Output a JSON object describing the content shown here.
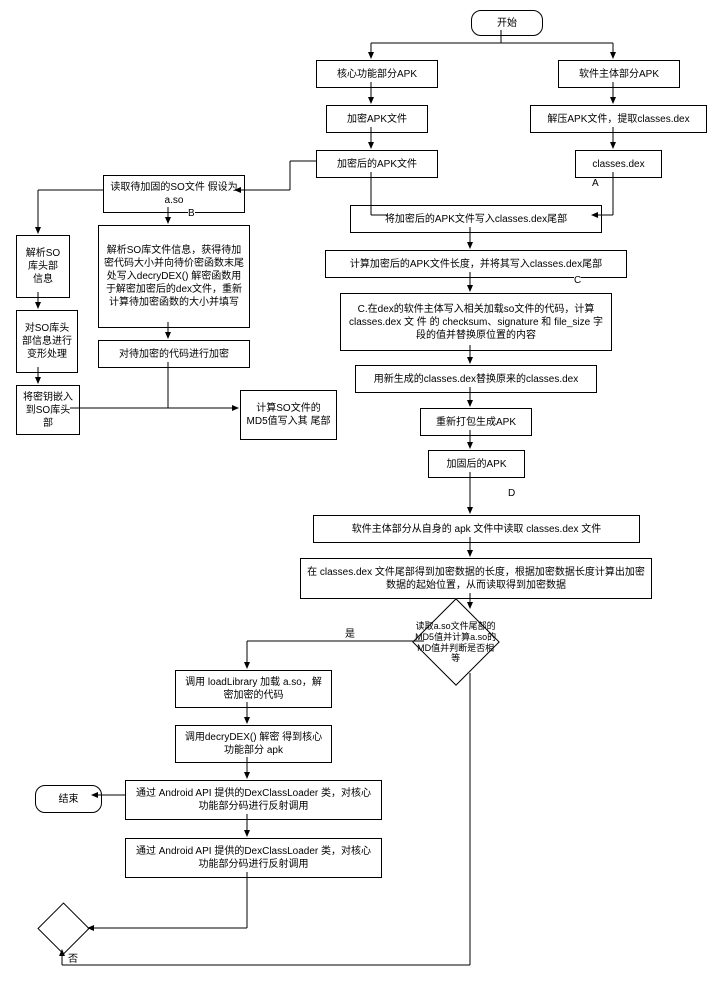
{
  "start": "开始",
  "end": "结束",
  "core_apk": "核心功能部分APK",
  "main_apk": "软件主体部分APK",
  "encrypt_apk": "加密APK文件",
  "extract_classes": "解压APK文件，提取classes.dex",
  "encrypted_apk": "加密后的APK文件",
  "classes_dex": "classes.dex",
  "read_so": "读取待加固的SO文件 假设为a.so",
  "parse_so_header": "解析SO 库头部 信息",
  "deform_so_header": "对SO库头 部信息进行 变形处理",
  "embed_key": "将密钥嵌入 到SO库头 部",
  "parse_so_info": "解析SO库文件信息，获得待加密代码大小并向待价密函数末尾处写入decryDEX() 解密函数用于解密加密后的dex文件，重新计算待加密函数的大小并填写",
  "encrypt_code": "对待加密的代码进行加密",
  "calc_md5_so": "计算SO文件的 MD5值写入其 尾部",
  "write_encrypted_to_dex": "将加密后的APK文件写入classes.dex尾部",
  "calc_apk_len": "计算加密后的APK文件长度，并将其写入classes.dex尾部",
  "write_loader": "C.在dex的软件主体写入相关加载so文件的代码，计算 classes.dex 文 件 的 checksum、signature 和 file_size 字段的值并替换原位置的内容",
  "replace_dex": "用新生成的classes.dex替换原来的classes.dex",
  "repackage": "重新打包生成APK",
  "hardened_apk": "加固后的APK",
  "read_dex_from_apk": "软件主体部分从自身的 apk 文件中读取 classes.dex 文件",
  "read_enc_data": "在 classes.dex 文件尾部得到加密数据的长度，根据加密数据长度计算出加密数据的起始位置，从而读取得到加密数据",
  "check_md5": "读取a.so文件尾部的MD5值并计算a.so的MD值并判断是否相等",
  "load_lib": "调用 loadLibrary 加载 a.so，解密加密的代码",
  "decrypt_dex": "调用decryDEX() 解密 得到核心功能部分 apk",
  "reflect1": "通过 Android API 提供的DexClassLoader 类，对核心功能部分码进行反射调用",
  "reflect2": "通过 Android API 提供的DexClassLoader 类，对核心功能部分码进行反射调用",
  "label_a": "A",
  "label_b": "B",
  "label_c": "C",
  "label_d": "D",
  "label_yes": "是",
  "label_no": "否"
}
